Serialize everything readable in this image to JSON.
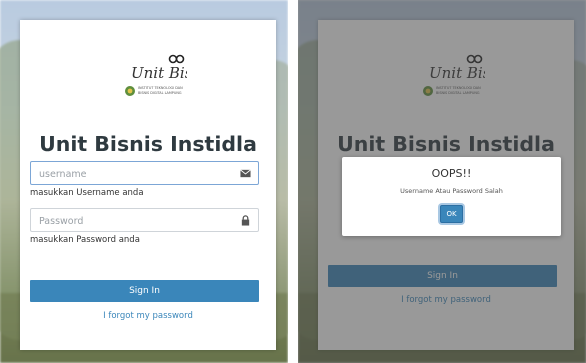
{
  "login": {
    "title": "Unit Bisnis Instidla",
    "username_placeholder": "username",
    "username_hint": "masukkan Username anda",
    "password_placeholder": "Password",
    "password_hint": "masukkan Password anda",
    "sign_in": "Sign In",
    "forgot": "I forgot my password"
  },
  "logo": {
    "script_text": "Unit Bisnis",
    "subtitle_line1": "INSTITUT TEKNOLOGI DAN",
    "subtitle_line2": "BISNIS DIGITAL LAMPUNG"
  },
  "dialog": {
    "title": "OOPS!!",
    "message": "Username Atau Password Salah",
    "ok": "OK"
  },
  "icons": {
    "username": "envelope-icon",
    "password": "lock-icon"
  },
  "colors": {
    "primary": "#3a86ba",
    "title": "#2f3a40",
    "overlay": "#464646"
  }
}
